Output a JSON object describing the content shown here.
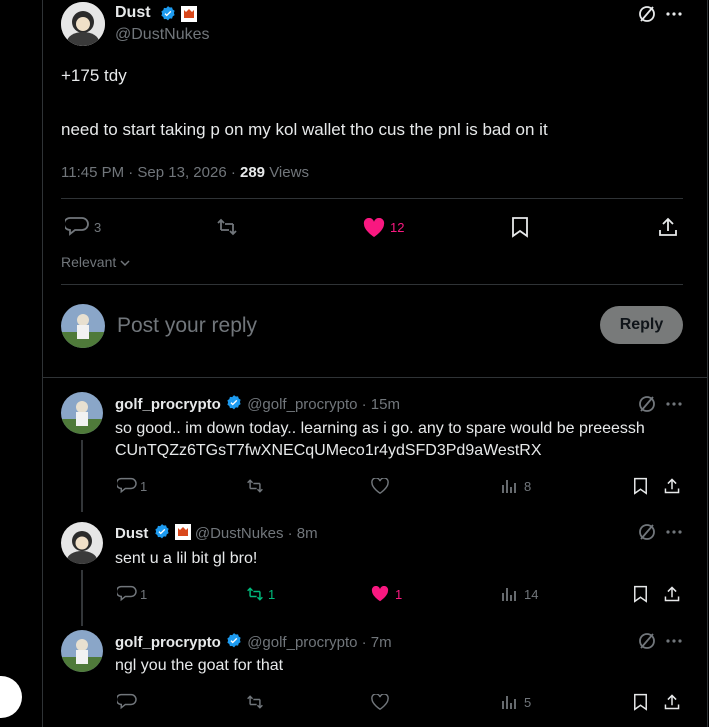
{
  "colors": {
    "accent": "#1d9bf0",
    "like": "#f91880",
    "repost": "#00ba7c",
    "muted": "#71767b",
    "border": "#2f3336"
  },
  "main_post": {
    "name": "Dust",
    "handle": "@DustNukes",
    "line1": "+175 tdy",
    "line2": "need to start taking p on my kol wallet tho cus the pnl is bad on it",
    "time": "11:45 PM · Sep 13, 2026 · ",
    "views_count": "289",
    "views_label": " Views",
    "replies": "3",
    "likes": "12",
    "sort_label": "Relevant"
  },
  "composer": {
    "placeholder": "Post your reply",
    "button": "Reply"
  },
  "replies": [
    {
      "name": "golf_procrypto",
      "handle": "@golf_procrypto",
      "age": "· 15m",
      "text1": "so good.. im down today.. learning as i go. any to spare would be preeessh",
      "text2": "CUnTQZz6TGsT7fwXNECqUMeco1r4ydSFD3Pd9aWestRX",
      "replies": "1",
      "reposts": "",
      "likes": "",
      "views": "8"
    },
    {
      "name": "Dust",
      "handle": "@DustNukes",
      "age": "· 8m",
      "text1": "sent u a lil bit gl bro!",
      "replies": "1",
      "reposts": "1",
      "likes": "1",
      "views": "14"
    },
    {
      "name": "golf_procrypto",
      "handle": "@golf_procrypto",
      "age": "· 7m",
      "text1": "ngl you the goat for that",
      "replies": "",
      "reposts": "",
      "likes": "",
      "views": "5"
    }
  ]
}
